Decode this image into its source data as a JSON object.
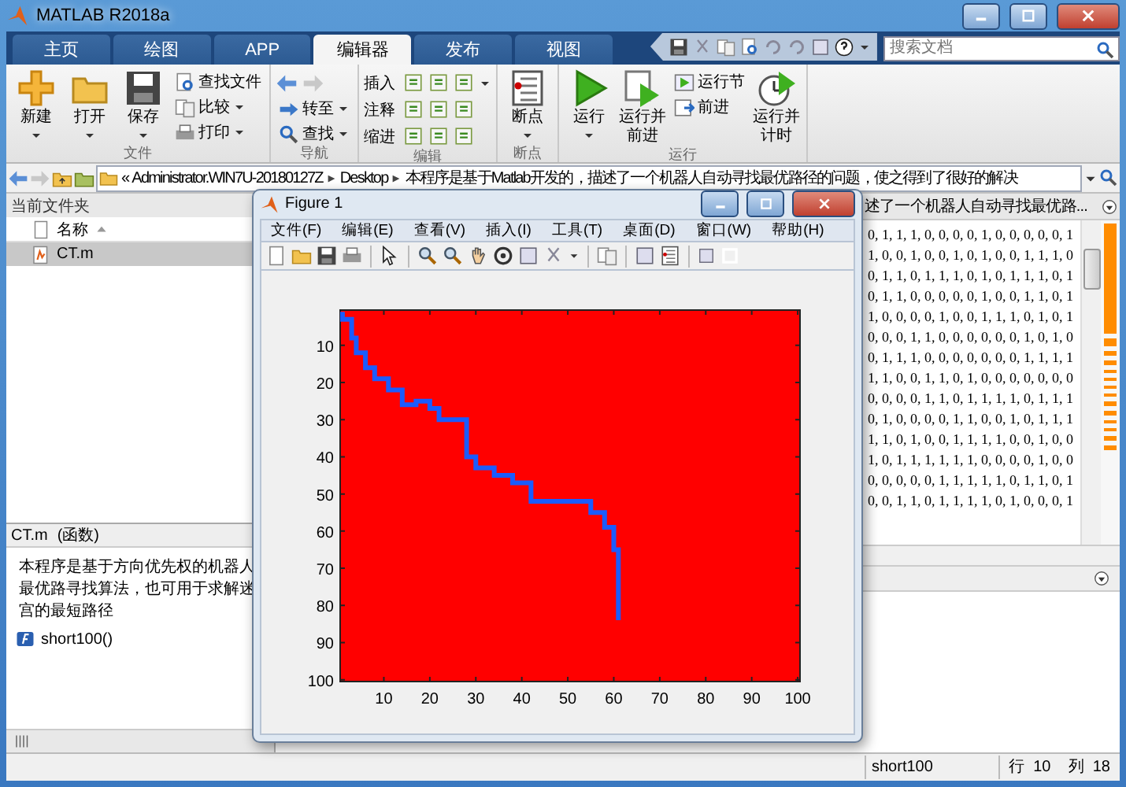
{
  "window": {
    "title": "MATLAB R2018a"
  },
  "tabs": [
    {
      "label": "主页",
      "selected": false
    },
    {
      "label": "绘图",
      "selected": false
    },
    {
      "label": "APP",
      "selected": false
    },
    {
      "label": "编辑器",
      "selected": true
    },
    {
      "label": "发布",
      "selected": false
    },
    {
      "label": "视图",
      "selected": false
    }
  ],
  "search": {
    "placeholder": "搜索文档"
  },
  "ribbon": [
    {
      "label": "文件",
      "items": [
        {
          "kind": "large",
          "label": "新建",
          "dropdown": true
        },
        {
          "kind": "large",
          "label": "打开",
          "dropdown": true
        },
        {
          "kind": "large",
          "label": "保存",
          "dropdown": true
        },
        {
          "kind": "stack",
          "rows": [
            {
              "kind": "text",
              "label": "查找文件",
              "dropdown": false
            },
            {
              "kind": "text",
              "label": "比较",
              "dropdown": true
            },
            {
              "kind": "text",
              "label": "打印",
              "dropdown": true
            }
          ]
        }
      ]
    },
    {
      "label": "导航",
      "items": [
        {
          "kind": "stack",
          "rows": [
            {
              "kind": "arrows"
            },
            {
              "kind": "text",
              "label": "转至",
              "dropdown": true
            },
            {
              "kind": "text",
              "label": "查找",
              "dropdown": true
            }
          ]
        }
      ]
    },
    {
      "label": "编辑",
      "items": [
        {
          "kind": "stack",
          "rows": [
            {
              "kind": "tools",
              "label": "插入",
              "dropdown": true
            },
            {
              "kind": "tools",
              "label": "注释",
              "dropdown": false
            },
            {
              "kind": "tools",
              "label": "缩进",
              "dropdown": false
            }
          ]
        }
      ]
    },
    {
      "label": "断点",
      "items": [
        {
          "kind": "large",
          "label": "断点",
          "dropdown": true
        }
      ]
    },
    {
      "label": "运行",
      "items": [
        {
          "kind": "large",
          "label": "运行",
          "dropdown": true
        },
        {
          "kind": "large",
          "label": "运行并前进",
          "dropdown": false
        },
        {
          "kind": "stack",
          "rows": [
            {
              "kind": "text",
              "label": "运行节",
              "dropdown": false
            },
            {
              "kind": "text",
              "label": "前进",
              "dropdown": false
            }
          ]
        },
        {
          "kind": "large",
          "label": "运行并计时",
          "dropdown": false
        }
      ]
    }
  ],
  "address": {
    "overflow_mark": "«",
    "path": [
      "Administrator.WIN7U-20180127Z",
      "Desktop",
      "本程序是基于Matlab开发的，描述了一个机器人自动寻找最优路径的问题，使之得到了很好的解决"
    ]
  },
  "current_folder": {
    "title": "当前文件夹",
    "column": "名称",
    "files": [
      {
        "name": "CT.m",
        "selected": true
      }
    ]
  },
  "details": {
    "file": "CT.m",
    "type": "(函数)",
    "description": "本程序是基于方向优先权的机器人最优路寻找算法，也可用于求解迷宫的最短路径",
    "functions": [
      "short100()"
    ]
  },
  "editor": {
    "tab_title": "述了一个机器人自动寻找最优路...",
    "lines": [
      "0, 1, 1, 1, 0, 0, 0, 0, 1, 0, 0, 0, 0, 0, 1",
      "1, 0, 0, 1, 0, 0, 1, 0, 1, 0, 0, 1, 1, 1, 0",
      "0, 1, 1, 0, 1, 1, 1, 0, 1, 0, 1, 1, 1, 0, 1",
      "0, 1, 1, 0, 0, 0, 0, 0, 1, 0, 0, 1, 1, 0, 1",
      "1, 0, 0, 0, 0, 1, 0, 0, 1, 1, 1, 0, 1, 0, 1",
      "0, 0, 0, 1, 1, 0, 0, 0, 0, 0, 0, 1, 0, 1, 0",
      "0, 1, 1, 1, 0, 0, 0, 0, 0, 0, 0, 1, 1, 1, 1",
      "1, 1, 0, 0, 1, 1, 0, 1, 0, 0, 0, 0, 0, 0, 0",
      "0, 0, 0, 0, 1, 1, 0, 1, 1, 1, 1, 0, 1, 1, 1",
      "0, 1, 0, 0, 0, 0, 1, 1, 0, 0, 1, 0, 1, 1, 1",
      "1, 1, 0, 1, 0, 0, 1, 1, 1, 1, 0, 0, 1, 0, 0",
      "1, 0, 1, 1, 1, 1, 1, 1, 0, 0, 0, 0, 1, 0, 0",
      "0, 0, 0, 0, 0, 1, 1, 1, 1, 1, 0, 1, 1, 0, 1",
      "0, 0, 1, 1, 0, 1, 1, 1, 1, 0, 1, 0, 0, 0, 1"
    ]
  },
  "figure": {
    "title": "Figure 1",
    "menus": [
      "文件(F)",
      "编辑(E)",
      "查看(V)",
      "插入(I)",
      "工具(T)",
      "桌面(D)",
      "窗口(W)",
      "帮助(H)"
    ],
    "chart_data": {
      "type": "line",
      "xlim": [
        0.5,
        100.5
      ],
      "ylim": [
        100.5,
        0.5
      ],
      "xticks": [
        10,
        20,
        30,
        40,
        50,
        60,
        70,
        80,
        90,
        100
      ],
      "yticks": [
        10,
        20,
        30,
        40,
        50,
        60,
        70,
        80,
        90,
        100
      ],
      "x": [
        1,
        1,
        3,
        3,
        4,
        4,
        6,
        6,
        8,
        8,
        11,
        11,
        14,
        14,
        17,
        17,
        20,
        20,
        22,
        22,
        28,
        28,
        30,
        30,
        34,
        34,
        38,
        38,
        42,
        42,
        55,
        55,
        58,
        58,
        60,
        60,
        61,
        61
      ],
      "series": [
        {
          "color": "#1a5cff",
          "values": [
            1,
            3,
            3,
            8,
            8,
            12,
            12,
            16,
            16,
            19,
            19,
            22,
            22,
            26,
            26,
            25,
            25,
            27,
            27,
            30,
            30,
            40,
            40,
            43,
            43,
            45,
            45,
            47,
            47,
            52,
            52,
            55,
            55,
            59,
            59,
            65,
            65,
            84
          ]
        }
      ]
    }
  },
  "status_bar": {
    "function": "short100",
    "row_label": "行",
    "row": "10",
    "col_label": "列",
    "col": "18"
  }
}
